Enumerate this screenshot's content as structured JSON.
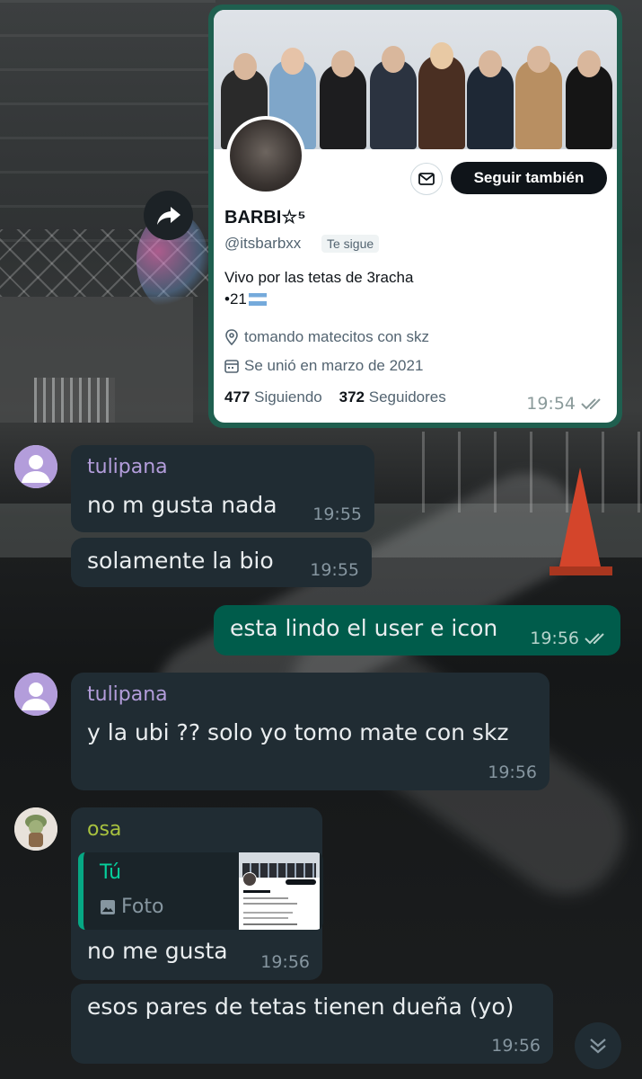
{
  "profile_card": {
    "name": "BARBI☆⁵",
    "handle": "@itsbarbxx",
    "follows_you": "Te sigue",
    "follow_button": "Seguir también",
    "bio_line1": "Vivo por las tetas de 3racha",
    "bio_line2": "•21",
    "location": "tomando matecitos con skz",
    "joined": "Se unió en marzo de 2021",
    "following_count": "477",
    "following_label": "Siguiendo",
    "followers_count": "372",
    "followers_label": "Seguidores",
    "time": "19:54"
  },
  "messages": [
    {
      "sender": "tulipana",
      "text": "no m gusta nada",
      "time": "19:55"
    },
    {
      "text": "solamente la bio",
      "time": "19:55"
    },
    {
      "text": "esta lindo el user e icon",
      "time": "19:56",
      "outgoing": true
    },
    {
      "sender": "tulipana",
      "text": "y la ubi ?? solo yo tomo mate con skz",
      "time": "19:56"
    },
    {
      "sender": "osa",
      "reply_author": "Tú",
      "reply_type": "Foto",
      "text": "no me gusta",
      "time": "19:56"
    },
    {
      "text": "esos pares de tetas tienen dueña (yo)",
      "time": "19:56"
    }
  ],
  "colors": {
    "incoming_bubble": "#202c33",
    "outgoing_bubble": "#005c4b",
    "sender_tulipana": "#b39ddb",
    "sender_osa": "#a8c23f",
    "accent": "#06cf9c"
  },
  "icons": [
    "share-icon",
    "mail-icon",
    "location-icon",
    "calendar-icon",
    "double-check-icon",
    "photo-icon",
    "scroll-down-icon",
    "default-avatar-icon"
  ]
}
